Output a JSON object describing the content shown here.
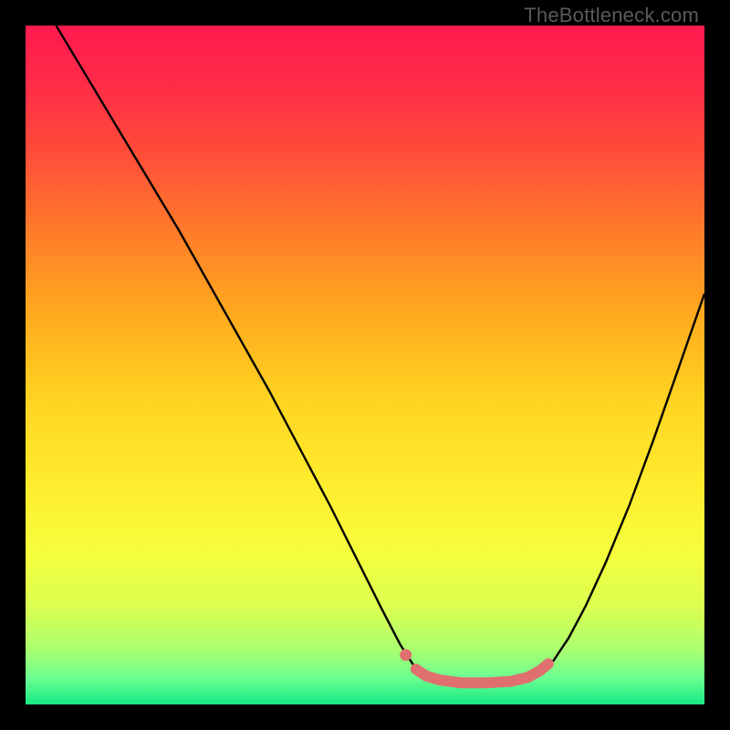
{
  "watermark": "TheBottleneck.com",
  "gradient": {
    "stops": [
      {
        "offset": 0.0,
        "color": "#ff1a4e"
      },
      {
        "offset": 0.08,
        "color": "#ff2a49"
      },
      {
        "offset": 0.18,
        "color": "#ff4a3a"
      },
      {
        "offset": 0.3,
        "color": "#ff7a2a"
      },
      {
        "offset": 0.42,
        "color": "#ffa81e"
      },
      {
        "offset": 0.55,
        "color": "#ffd321"
      },
      {
        "offset": 0.68,
        "color": "#ffed2e"
      },
      {
        "offset": 0.78,
        "color": "#f5ff3d"
      },
      {
        "offset": 0.86,
        "color": "#d9ff52"
      },
      {
        "offset": 0.92,
        "color": "#a9ff6f"
      },
      {
        "offset": 0.96,
        "color": "#6dff91"
      },
      {
        "offset": 1.0,
        "color": "#17e884"
      }
    ]
  },
  "curve": {
    "color": "#000000",
    "width": 2.4,
    "points": [
      [
        0.045,
        0.0
      ],
      [
        0.09,
        0.075
      ],
      [
        0.135,
        0.15
      ],
      [
        0.18,
        0.225
      ],
      [
        0.225,
        0.3
      ],
      [
        0.27,
        0.38
      ],
      [
        0.315,
        0.46
      ],
      [
        0.36,
        0.54
      ],
      [
        0.405,
        0.625
      ],
      [
        0.45,
        0.71
      ],
      [
        0.49,
        0.79
      ],
      [
        0.525,
        0.86
      ],
      [
        0.552,
        0.912
      ],
      [
        0.57,
        0.94
      ],
      [
        0.582,
        0.956
      ],
      [
        0.595,
        0.964
      ],
      [
        0.61,
        0.968
      ],
      [
        0.635,
        0.97
      ],
      [
        0.675,
        0.97
      ],
      [
        0.715,
        0.968
      ],
      [
        0.74,
        0.963
      ],
      [
        0.76,
        0.952
      ],
      [
        0.778,
        0.935
      ],
      [
        0.8,
        0.902
      ],
      [
        0.825,
        0.855
      ],
      [
        0.855,
        0.79
      ],
      [
        0.89,
        0.705
      ],
      [
        0.925,
        0.61
      ],
      [
        0.96,
        0.51
      ],
      [
        1.0,
        0.395
      ]
    ]
  },
  "pink_segment": {
    "color": "#e07070",
    "width": 12,
    "cap": "round",
    "points": [
      [
        0.575,
        0.948
      ],
      [
        0.59,
        0.958
      ],
      [
        0.61,
        0.964
      ],
      [
        0.64,
        0.968
      ],
      [
        0.68,
        0.968
      ],
      [
        0.715,
        0.966
      ],
      [
        0.74,
        0.96
      ],
      [
        0.758,
        0.95
      ],
      [
        0.77,
        0.94
      ]
    ]
  },
  "pink_dot": {
    "color": "#e07070",
    "cx": 0.56,
    "cy": 0.927,
    "r": 6.5
  },
  "chart_data": {
    "type": "line",
    "title": "",
    "xlabel": "",
    "ylabel": "",
    "xlim": [
      0,
      1
    ],
    "ylim": [
      0,
      1
    ],
    "grid": false,
    "legend": false,
    "annotations": [
      "TheBottleneck.com"
    ],
    "series": [
      {
        "name": "bottleneck-curve",
        "x": [
          0.045,
          0.09,
          0.135,
          0.18,
          0.225,
          0.27,
          0.315,
          0.36,
          0.405,
          0.45,
          0.49,
          0.525,
          0.552,
          0.57,
          0.582,
          0.595,
          0.61,
          0.635,
          0.675,
          0.715,
          0.74,
          0.76,
          0.778,
          0.8,
          0.825,
          0.855,
          0.89,
          0.925,
          0.96,
          1.0
        ],
        "y": [
          1.0,
          0.925,
          0.85,
          0.775,
          0.7,
          0.62,
          0.54,
          0.46,
          0.375,
          0.29,
          0.21,
          0.14,
          0.088,
          0.06,
          0.044,
          0.036,
          0.032,
          0.03,
          0.03,
          0.032,
          0.037,
          0.048,
          0.065,
          0.098,
          0.145,
          0.21,
          0.295,
          0.39,
          0.49,
          0.605
        ]
      },
      {
        "name": "optimal-range-highlight",
        "x": [
          0.575,
          0.59,
          0.61,
          0.64,
          0.68,
          0.715,
          0.74,
          0.758,
          0.77
        ],
        "y": [
          0.052,
          0.042,
          0.036,
          0.032,
          0.032,
          0.034,
          0.04,
          0.05,
          0.06
        ]
      }
    ],
    "markers": [
      {
        "name": "optimal-point",
        "x": 0.56,
        "y": 0.073
      }
    ],
    "background": "vertical-gradient"
  }
}
